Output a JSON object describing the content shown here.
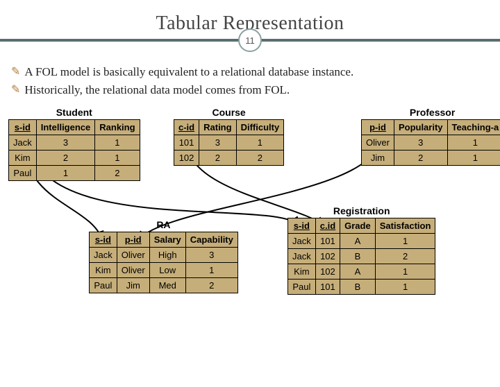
{
  "title": "Tabular Representation",
  "slide_number": "11",
  "bullets": [
    "A FOL model is basically equivalent to a relational database instance.",
    "Historically, the relational data model comes from FOL."
  ],
  "tables": {
    "student": {
      "caption": "Student",
      "headers": [
        "s-id",
        "Intelligence",
        "Ranking"
      ],
      "rows": [
        [
          "Jack",
          "3",
          "1"
        ],
        [
          "Kim",
          "2",
          "1"
        ],
        [
          "Paul",
          "1",
          "2"
        ]
      ]
    },
    "course": {
      "caption": "Course",
      "headers": [
        "c-id",
        "Rating",
        "Difficulty"
      ],
      "rows": [
        [
          "101",
          "3",
          "1"
        ],
        [
          "102",
          "2",
          "2"
        ]
      ]
    },
    "professor": {
      "caption": "Professor",
      "headers": [
        "p-id",
        "Popularity",
        "Teaching-a"
      ],
      "rows": [
        [
          "Oliver",
          "3",
          "1"
        ],
        [
          "Jim",
          "2",
          "1"
        ]
      ]
    },
    "ra": {
      "caption": "RA",
      "headers": [
        "s-id",
        "p-id",
        "Salary",
        "Capability"
      ],
      "rows": [
        [
          "Jack",
          "Oliver",
          "High",
          "3"
        ],
        [
          "Kim",
          "Oliver",
          "Low",
          "1"
        ],
        [
          "Paul",
          "Jim",
          "Med",
          "2"
        ]
      ]
    },
    "registration": {
      "caption": "Registration",
      "headers": [
        "s-id",
        "c.id",
        "Grade",
        "Satisfaction"
      ],
      "rows": [
        [
          "Jack",
          "101",
          "A",
          "1"
        ],
        [
          "Jack",
          "102",
          "B",
          "2"
        ],
        [
          "Kim",
          "102",
          "A",
          "1"
        ],
        [
          "Paul",
          "101",
          "B",
          "1"
        ]
      ]
    }
  },
  "chart_data": [
    {
      "type": "table",
      "title": "Student",
      "columns": [
        "s-id",
        "Intelligence",
        "Ranking"
      ],
      "rows": [
        [
          "Jack",
          3,
          1
        ],
        [
          "Kim",
          2,
          1
        ],
        [
          "Paul",
          1,
          2
        ]
      ]
    },
    {
      "type": "table",
      "title": "Course",
      "columns": [
        "c-id",
        "Rating",
        "Difficulty"
      ],
      "rows": [
        [
          101,
          3,
          1
        ],
        [
          102,
          2,
          2
        ]
      ]
    },
    {
      "type": "table",
      "title": "Professor",
      "columns": [
        "p-id",
        "Popularity",
        "Teaching-a"
      ],
      "rows": [
        [
          "Oliver",
          3,
          1
        ],
        [
          "Jim",
          2,
          1
        ]
      ]
    },
    {
      "type": "table",
      "title": "RA",
      "columns": [
        "s-id",
        "p-id",
        "Salary",
        "Capability"
      ],
      "rows": [
        [
          "Jack",
          "Oliver",
          "High",
          3
        ],
        [
          "Kim",
          "Oliver",
          "Low",
          1
        ],
        [
          "Paul",
          "Jim",
          "Med",
          2
        ]
      ]
    },
    {
      "type": "table",
      "title": "Registration",
      "columns": [
        "s-id",
        "c.id",
        "Grade",
        "Satisfaction"
      ],
      "rows": [
        [
          "Jack",
          101,
          "A",
          1
        ],
        [
          "Jack",
          102,
          "B",
          2
        ],
        [
          "Kim",
          102,
          "A",
          1
        ],
        [
          "Paul",
          101,
          "B",
          1
        ]
      ]
    }
  ]
}
